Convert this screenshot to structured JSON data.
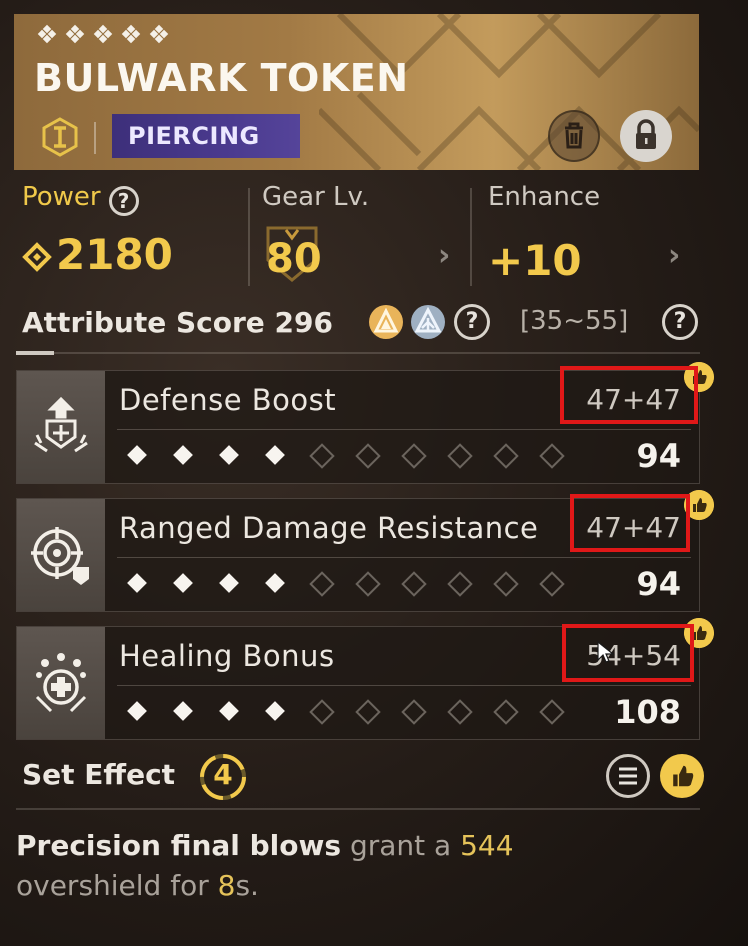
{
  "item": {
    "name": "BULWARK TOKEN",
    "rarity_count": 5,
    "type": "PIERCING",
    "tier_icon": "roman-one-icon"
  },
  "stats": {
    "power_label": "Power",
    "power_value": "2180",
    "gear_label": "Gear Lv.",
    "gear_value": "80",
    "enhance_label": "Enhance",
    "enhance_value": "+10"
  },
  "attribute": {
    "label": "Attribute Score",
    "score": "296",
    "range": "[35~55]"
  },
  "perks": [
    {
      "name": "Defense Boost",
      "roll": "47+47",
      "total": "94",
      "filled": 4,
      "max": 10,
      "icon": "defense-boost-icon"
    },
    {
      "name": "Ranged Damage Resistance",
      "roll": "47+47",
      "total": "94",
      "filled": 4,
      "max": 10,
      "icon": "ranged-resistance-icon"
    },
    {
      "name": "Healing Bonus",
      "roll": "54+54",
      "total": "108",
      "filled": 4,
      "max": 10,
      "icon": "healing-bonus-icon"
    }
  ],
  "set_effect": {
    "label": "Set Effect",
    "count": "4"
  },
  "description": {
    "bold": "Precision final blows",
    "text1": " grant a ",
    "value1": "544",
    "text2": "overshield for ",
    "value2": "8",
    "text3": "s."
  },
  "colors": {
    "accent": "#f2c94c",
    "type_badge": "#4a3a8e",
    "highlight_box": "#e01818"
  }
}
